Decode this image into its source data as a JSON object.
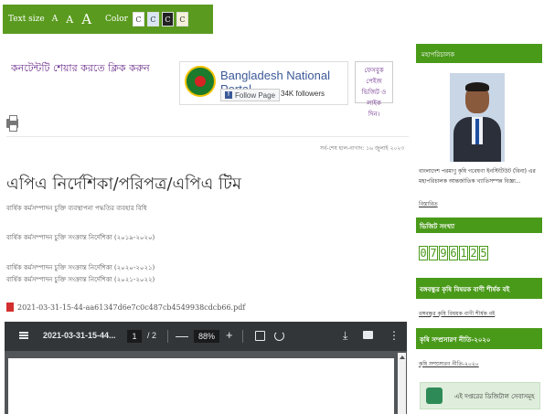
{
  "toolbar": {
    "text_size_label": "Text size",
    "size_small": "A",
    "size_medium": "A",
    "size_large": "A",
    "color_label": "Color",
    "swatches": [
      {
        "label": "C",
        "bg": "#ffffff",
        "fg": "#333333"
      },
      {
        "label": "C",
        "bg": "#d8e6f5",
        "fg": "#333333"
      },
      {
        "label": "C",
        "bg": "#222222",
        "fg": "#ffffff"
      },
      {
        "label": "C",
        "bg": "#f4f1d8",
        "fg": "#333333"
      }
    ]
  },
  "share": {
    "label": "কনটেন্টটি শেয়ার করতে ক্লিক করুন"
  },
  "portal": {
    "name": "Bangladesh National Portal",
    "follow_label": "Follow Page",
    "followers": "34K followers"
  },
  "fb_box": {
    "line1": "ফেসবুক পেইজ",
    "line2": "ভিজিট ও লাইক",
    "line3": "দিন।"
  },
  "updated": "সর্ব-শেষ হাল-নাগাদ: ১৬ জুলাই ২০২৩",
  "page_title": "এপিএ নির্দেশিকা/পরিপত্র/এপিএ টিম",
  "documents": [
    "বার্ষিক কর্মসম্পাদন চুক্তি ব্যবস্থাপনা পদ্ধতির ব্যবহার বিধি",
    "বার্ষিক কর্মসম্পাদন চুক্তি সংক্রান্ত নির্দেশিকা (২০১৯-২০২০)",
    "বার্ষিক কর্মসম্পাদন চুক্তি সংক্রান্ত নির্দেশিকা (২০২০-২০২১)",
    "বার্ষিক কর্মসম্পাদন চুক্তি সংক্রান্ত নির্দেশিকা (২০২১-২০২২)"
  ],
  "attachment": "2021-03-31-15-44-aa61347d6e7c0c487cb4549938cdcb66.pdf",
  "viewer": {
    "filename": "2021-03-31-15-44...",
    "page_current": "1",
    "page_total": "/ 2",
    "zoom": "88%",
    "minus": "—",
    "plus": "+",
    "download": "⤓",
    "more": "⋮"
  },
  "sidebar": {
    "head": "মহাপরিচালক",
    "desc": "বাংলাদেশ পরমাণু কৃষি গবেষণা ইনস্টিটিউট (বিনা) এর মহাপরিচালক আন্তর্জাতিক খ্যাতিসম্পন্ন বিজ্ঞা...",
    "more": "বিস্তারিত",
    "visit_head": "ভিজিট সংখ্যা",
    "counter": [
      "0",
      "7",
      "9",
      "6",
      "1",
      "2",
      "5"
    ],
    "block1_head": "বঙ্গবন্ধুর কৃষি বিষয়ক বাণী শীর্ষক বই",
    "block1_link": "বঙ্গবন্ধুর কৃষি বিষয়ক বাণী শীর্ষক বই",
    "block2_head": "কৃষি সম্প্রসারণ নীতি-২০২০",
    "block2_link": "কৃষি সম্প্রসারণ নীতি-২০২০",
    "banner": "এই দপ্তরের ডিজিটাল সেবাসমূহ"
  }
}
